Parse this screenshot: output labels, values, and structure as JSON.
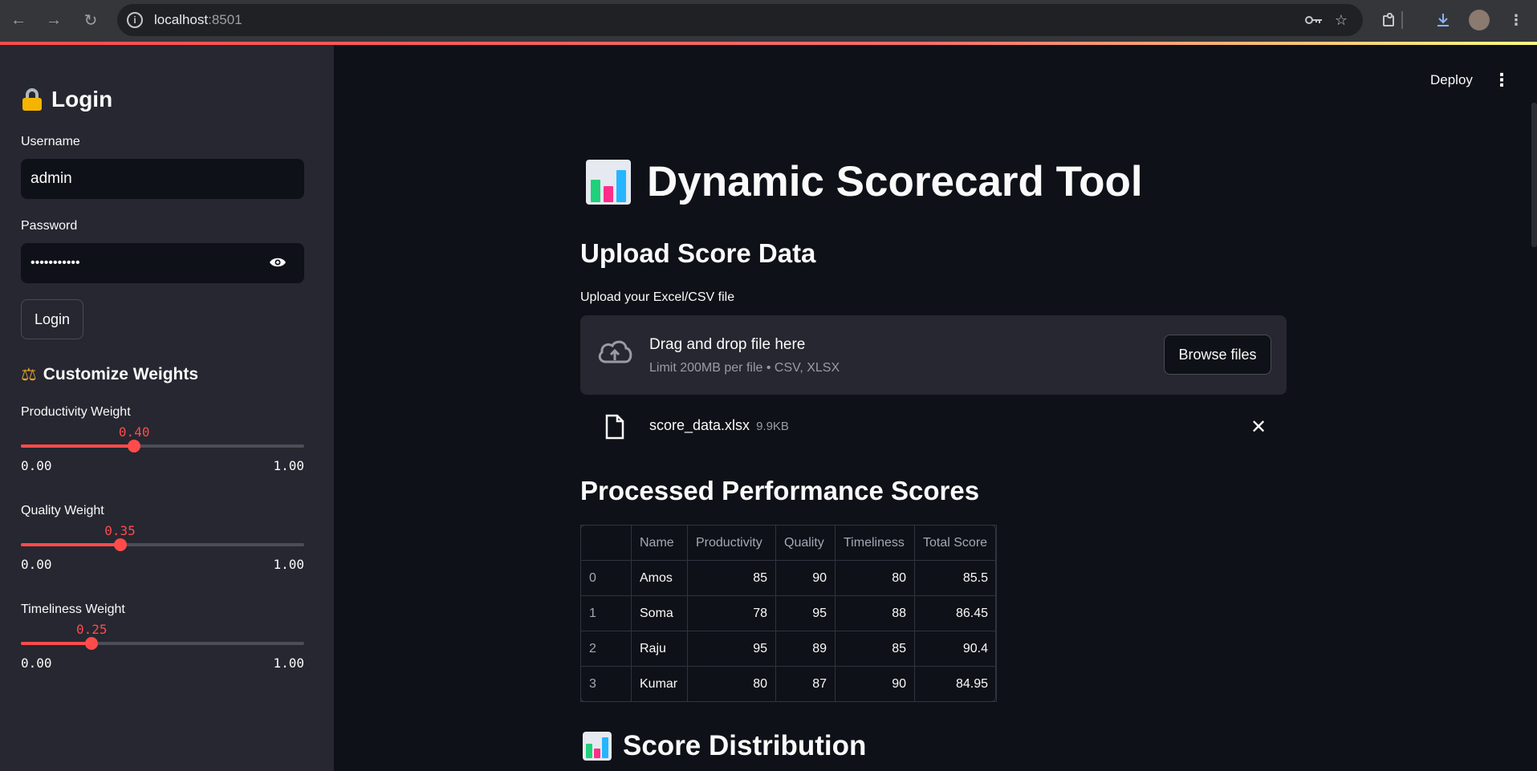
{
  "browser": {
    "url_host": "localhost",
    "url_port": ":8501"
  },
  "sidebar": {
    "login_title": "Login",
    "username_label": "Username",
    "username_value": "admin",
    "password_label": "Password",
    "password_value": "•••••••••••",
    "login_button": "Login",
    "weights_heading": "Customize Weights",
    "sliders": [
      {
        "label": "Productivity Weight",
        "value": "0.40",
        "fraction": 0.4,
        "min": "0.00",
        "max": "1.00"
      },
      {
        "label": "Quality Weight",
        "value": "0.35",
        "fraction": 0.35,
        "min": "0.00",
        "max": "1.00"
      },
      {
        "label": "Timeliness Weight",
        "value": "0.25",
        "fraction": 0.25,
        "min": "0.00",
        "max": "1.00"
      }
    ]
  },
  "header": {
    "deploy_label": "Deploy"
  },
  "main": {
    "title": "Dynamic Scorecard Tool",
    "upload_heading": "Upload Score Data",
    "upload_label": "Upload your Excel/CSV file",
    "dropzone_main": "Drag and drop file here",
    "dropzone_sub": "Limit 200MB per file • CSV, XLSX",
    "browse_button": "Browse files",
    "file_name": "score_data.xlsx",
    "file_size": "9.9KB",
    "scores_heading": "Processed Performance Scores",
    "table": {
      "columns": [
        "",
        "Name",
        "Productivity",
        "Quality",
        "Timeliness",
        "Total Score"
      ],
      "rows": [
        [
          "0",
          "Amos",
          "85",
          "90",
          "80",
          "85.5"
        ],
        [
          "1",
          "Soma",
          "78",
          "95",
          "88",
          "86.45"
        ],
        [
          "2",
          "Raju",
          "95",
          "89",
          "85",
          "90.4"
        ],
        [
          "3",
          "Kumar",
          "80",
          "87",
          "90",
          "84.95"
        ]
      ]
    },
    "distribution_heading": "Score Distribution"
  },
  "colors": {
    "accent": "#ff4b4b",
    "background": "#0e1117",
    "sidebar": "#262730"
  }
}
